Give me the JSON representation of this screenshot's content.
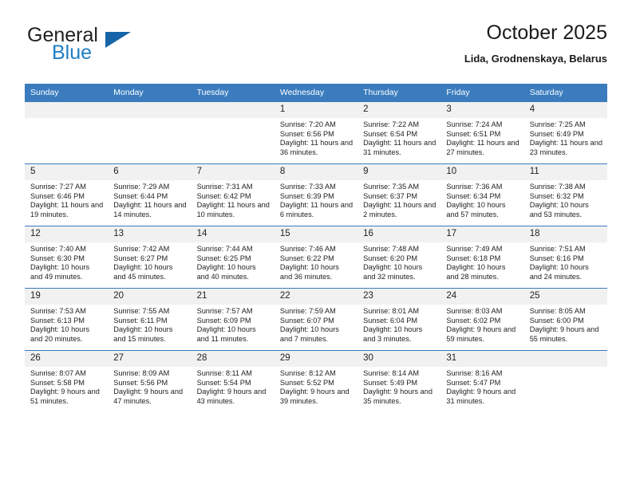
{
  "brand": {
    "name_top": "General",
    "name_bottom": "Blue",
    "triangle_icon": "brand-triangle-icon",
    "accent_color": "#1f7fc4"
  },
  "header": {
    "title": "October 2025",
    "subtitle": "Lida, Grodnenskaya, Belarus"
  },
  "theme": {
    "header_row_bg": "#3a7cbe",
    "daynum_bg": "#f1f1f1",
    "grid_line": "#3a7cbe",
    "text": "#222222"
  },
  "weekdays": [
    "Sunday",
    "Monday",
    "Tuesday",
    "Wednesday",
    "Thursday",
    "Friday",
    "Saturday"
  ],
  "labels": {
    "sunrise_prefix": "Sunrise:",
    "sunset_prefix": "Sunset:",
    "daylight_prefix": "Daylight:"
  },
  "weeks": [
    [
      {
        "day": "",
        "blank": true
      },
      {
        "day": "",
        "blank": true
      },
      {
        "day": "",
        "blank": true
      },
      {
        "day": "1",
        "sunrise": "Sunrise: 7:20 AM",
        "sunset": "Sunset: 6:56 PM",
        "daylight": "Daylight: 11 hours and 36 minutes."
      },
      {
        "day": "2",
        "sunrise": "Sunrise: 7:22 AM",
        "sunset": "Sunset: 6:54 PM",
        "daylight": "Daylight: 11 hours and 31 minutes."
      },
      {
        "day": "3",
        "sunrise": "Sunrise: 7:24 AM",
        "sunset": "Sunset: 6:51 PM",
        "daylight": "Daylight: 11 hours and 27 minutes."
      },
      {
        "day": "4",
        "sunrise": "Sunrise: 7:25 AM",
        "sunset": "Sunset: 6:49 PM",
        "daylight": "Daylight: 11 hours and 23 minutes."
      }
    ],
    [
      {
        "day": "5",
        "sunrise": "Sunrise: 7:27 AM",
        "sunset": "Sunset: 6:46 PM",
        "daylight": "Daylight: 11 hours and 19 minutes."
      },
      {
        "day": "6",
        "sunrise": "Sunrise: 7:29 AM",
        "sunset": "Sunset: 6:44 PM",
        "daylight": "Daylight: 11 hours and 14 minutes."
      },
      {
        "day": "7",
        "sunrise": "Sunrise: 7:31 AM",
        "sunset": "Sunset: 6:42 PM",
        "daylight": "Daylight: 11 hours and 10 minutes."
      },
      {
        "day": "8",
        "sunrise": "Sunrise: 7:33 AM",
        "sunset": "Sunset: 6:39 PM",
        "daylight": "Daylight: 11 hours and 6 minutes."
      },
      {
        "day": "9",
        "sunrise": "Sunrise: 7:35 AM",
        "sunset": "Sunset: 6:37 PM",
        "daylight": "Daylight: 11 hours and 2 minutes."
      },
      {
        "day": "10",
        "sunrise": "Sunrise: 7:36 AM",
        "sunset": "Sunset: 6:34 PM",
        "daylight": "Daylight: 10 hours and 57 minutes."
      },
      {
        "day": "11",
        "sunrise": "Sunrise: 7:38 AM",
        "sunset": "Sunset: 6:32 PM",
        "daylight": "Daylight: 10 hours and 53 minutes."
      }
    ],
    [
      {
        "day": "12",
        "sunrise": "Sunrise: 7:40 AM",
        "sunset": "Sunset: 6:30 PM",
        "daylight": "Daylight: 10 hours and 49 minutes."
      },
      {
        "day": "13",
        "sunrise": "Sunrise: 7:42 AM",
        "sunset": "Sunset: 6:27 PM",
        "daylight": "Daylight: 10 hours and 45 minutes."
      },
      {
        "day": "14",
        "sunrise": "Sunrise: 7:44 AM",
        "sunset": "Sunset: 6:25 PM",
        "daylight": "Daylight: 10 hours and 40 minutes."
      },
      {
        "day": "15",
        "sunrise": "Sunrise: 7:46 AM",
        "sunset": "Sunset: 6:22 PM",
        "daylight": "Daylight: 10 hours and 36 minutes."
      },
      {
        "day": "16",
        "sunrise": "Sunrise: 7:48 AM",
        "sunset": "Sunset: 6:20 PM",
        "daylight": "Daylight: 10 hours and 32 minutes."
      },
      {
        "day": "17",
        "sunrise": "Sunrise: 7:49 AM",
        "sunset": "Sunset: 6:18 PM",
        "daylight": "Daylight: 10 hours and 28 minutes."
      },
      {
        "day": "18",
        "sunrise": "Sunrise: 7:51 AM",
        "sunset": "Sunset: 6:16 PM",
        "daylight": "Daylight: 10 hours and 24 minutes."
      }
    ],
    [
      {
        "day": "19",
        "sunrise": "Sunrise: 7:53 AM",
        "sunset": "Sunset: 6:13 PM",
        "daylight": "Daylight: 10 hours and 20 minutes."
      },
      {
        "day": "20",
        "sunrise": "Sunrise: 7:55 AM",
        "sunset": "Sunset: 6:11 PM",
        "daylight": "Daylight: 10 hours and 15 minutes."
      },
      {
        "day": "21",
        "sunrise": "Sunrise: 7:57 AM",
        "sunset": "Sunset: 6:09 PM",
        "daylight": "Daylight: 10 hours and 11 minutes."
      },
      {
        "day": "22",
        "sunrise": "Sunrise: 7:59 AM",
        "sunset": "Sunset: 6:07 PM",
        "daylight": "Daylight: 10 hours and 7 minutes."
      },
      {
        "day": "23",
        "sunrise": "Sunrise: 8:01 AM",
        "sunset": "Sunset: 6:04 PM",
        "daylight": "Daylight: 10 hours and 3 minutes."
      },
      {
        "day": "24",
        "sunrise": "Sunrise: 8:03 AM",
        "sunset": "Sunset: 6:02 PM",
        "daylight": "Daylight: 9 hours and 59 minutes."
      },
      {
        "day": "25",
        "sunrise": "Sunrise: 8:05 AM",
        "sunset": "Sunset: 6:00 PM",
        "daylight": "Daylight: 9 hours and 55 minutes."
      }
    ],
    [
      {
        "day": "26",
        "sunrise": "Sunrise: 8:07 AM",
        "sunset": "Sunset: 5:58 PM",
        "daylight": "Daylight: 9 hours and 51 minutes."
      },
      {
        "day": "27",
        "sunrise": "Sunrise: 8:09 AM",
        "sunset": "Sunset: 5:56 PM",
        "daylight": "Daylight: 9 hours and 47 minutes."
      },
      {
        "day": "28",
        "sunrise": "Sunrise: 8:11 AM",
        "sunset": "Sunset: 5:54 PM",
        "daylight": "Daylight: 9 hours and 43 minutes."
      },
      {
        "day": "29",
        "sunrise": "Sunrise: 8:12 AM",
        "sunset": "Sunset: 5:52 PM",
        "daylight": "Daylight: 9 hours and 39 minutes."
      },
      {
        "day": "30",
        "sunrise": "Sunrise: 8:14 AM",
        "sunset": "Sunset: 5:49 PM",
        "daylight": "Daylight: 9 hours and 35 minutes."
      },
      {
        "day": "31",
        "sunrise": "Sunrise: 8:16 AM",
        "sunset": "Sunset: 5:47 PM",
        "daylight": "Daylight: 9 hours and 31 minutes."
      },
      {
        "day": "",
        "blank": true
      }
    ]
  ]
}
